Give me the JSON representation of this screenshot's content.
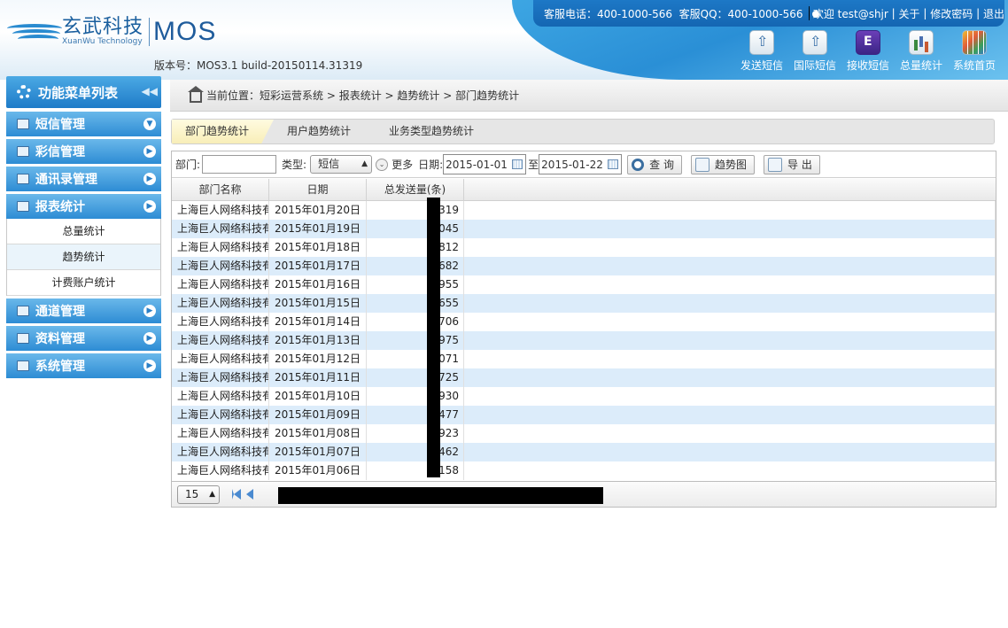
{
  "header": {
    "logo_cn": "玄武科技",
    "logo_en": "XuanWu Technology",
    "logo_product": "MOS",
    "version": "版本号：MOS3.1 build-20150114.31319",
    "topbar": {
      "hotline": "客服电话：400-1000-566",
      "qq": "客服QQ：400-1000-566",
      "welcome": "欢迎 test@shjr",
      "about": "关于",
      "change_password": "修改密码",
      "logout": "退出",
      "separator": "|"
    },
    "quick_actions": [
      {
        "label": "发送短信",
        "icon": "send-sms-icon"
      },
      {
        "label": "国际短信",
        "icon": "intl-sms-icon"
      },
      {
        "label": "接收短信",
        "icon": "receive-sms-icon"
      },
      {
        "label": "总量统计",
        "icon": "total-stats-icon"
      },
      {
        "label": "系统首页",
        "icon": "home-grid-icon"
      }
    ]
  },
  "sidebar": {
    "title": "功能菜单列表",
    "collapse_glyph": "◀◀",
    "items": [
      {
        "label": "短信管理",
        "arrow": "▼"
      },
      {
        "label": "彩信管理",
        "arrow": "▶"
      },
      {
        "label": "通讯录管理",
        "arrow": "▶"
      },
      {
        "label": "报表统计",
        "arrow": "▶"
      }
    ],
    "subitems": [
      "总量统计",
      "趋势统计",
      "计费账户统计"
    ],
    "active_subitem": "趋势统计",
    "items_after": [
      {
        "label": "通道管理",
        "arrow": "▶"
      },
      {
        "label": "资料管理",
        "arrow": "▶"
      },
      {
        "label": "系统管理",
        "arrow": "▶"
      }
    ]
  },
  "breadcrumb": {
    "prefix": "当前位置：",
    "path": "短彩运营系统 > 报表统计 > 趋势统计 > 部门趋势统计"
  },
  "tabs": [
    {
      "label": "部门趋势统计",
      "active": true
    },
    {
      "label": "用户趋势统计",
      "active": false
    },
    {
      "label": "业务类型趋势统计",
      "active": false
    }
  ],
  "filters": {
    "dept_label": "部门:",
    "dept_value": "",
    "type_label": "类型:",
    "type_value": "短信",
    "more_label": "更多",
    "date_label": "日期:",
    "date_from": "2015-01-01",
    "to_label": "至",
    "date_to": "2015-01-22",
    "query_label": "查  询",
    "chart_label": "趋势图",
    "export_label": "导  出"
  },
  "table": {
    "columns": [
      "部门名称",
      "日期",
      "总发送量(条)"
    ],
    "rows": [
      {
        "dept": "上海巨人网络科技有",
        "date": "2015年01月20日",
        "total": ",319"
      },
      {
        "dept": "上海巨人网络科技有",
        "date": "2015年01月19日",
        "total": ",045"
      },
      {
        "dept": "上海巨人网络科技有",
        "date": "2015年01月18日",
        "total": ",812"
      },
      {
        "dept": "上海巨人网络科技有",
        "date": "2015年01月17日",
        "total": ",682"
      },
      {
        "dept": "上海巨人网络科技有",
        "date": "2015年01月16日",
        "total": ",955"
      },
      {
        "dept": "上海巨人网络科技有",
        "date": "2015年01月15日",
        "total": ",655"
      },
      {
        "dept": "上海巨人网络科技有",
        "date": "2015年01月14日",
        "total": ",706"
      },
      {
        "dept": "上海巨人网络科技有",
        "date": "2015年01月13日",
        "total": ",975"
      },
      {
        "dept": "上海巨人网络科技有",
        "date": "2015年01月12日",
        "total": ",071"
      },
      {
        "dept": "上海巨人网络科技有",
        "date": "2015年01月11日",
        "total": ",725"
      },
      {
        "dept": "上海巨人网络科技有",
        "date": "2015年01月10日",
        "total": ",930"
      },
      {
        "dept": "上海巨人网络科技有",
        "date": "2015年01月09日",
        "total": ",477"
      },
      {
        "dept": "上海巨人网络科技有",
        "date": "2015年01月08日",
        "total": ",923"
      },
      {
        "dept": "上海巨人网络科技有",
        "date": "2015年01月07日",
        "total": ",462"
      },
      {
        "dept": "上海巨人网络科技有",
        "date": "2015年01月06日",
        "total": ",158"
      }
    ]
  },
  "pager": {
    "page_size": "15"
  }
}
